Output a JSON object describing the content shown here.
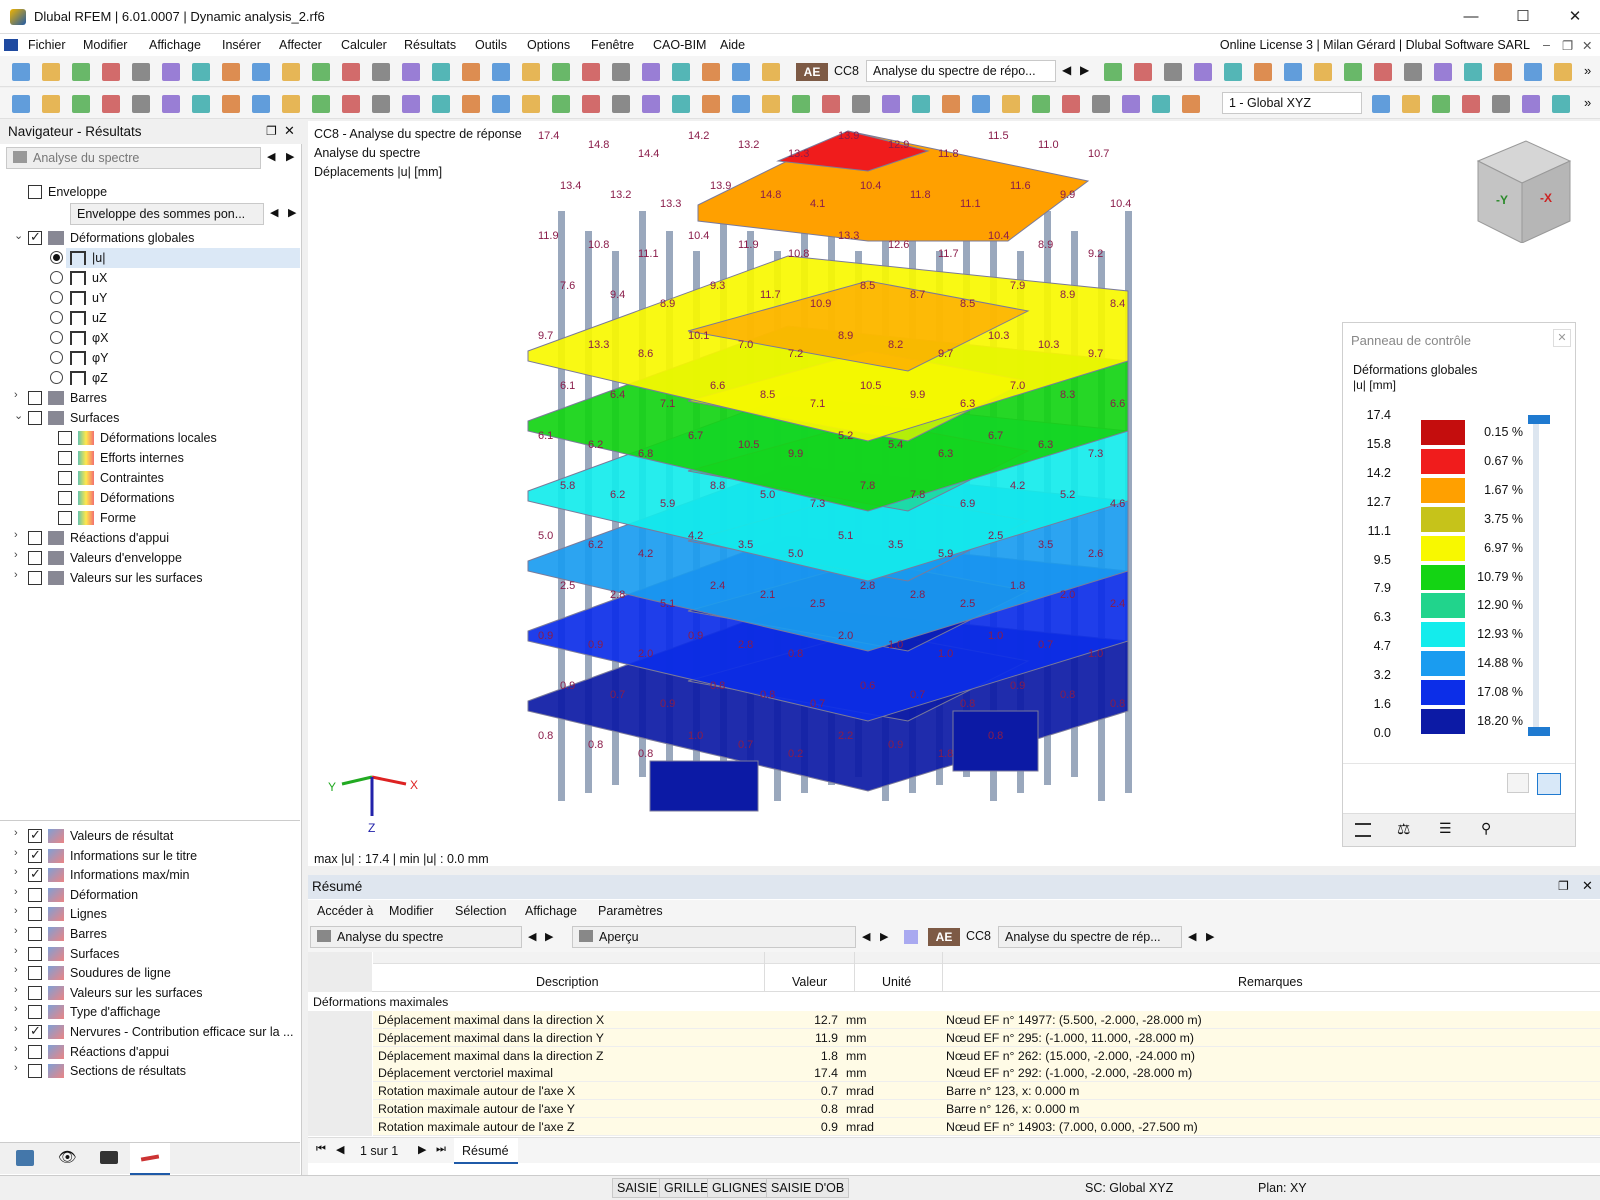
{
  "window": {
    "title": "Dlubal RFEM | 6.01.0007 | Dynamic analysis_2.rf6",
    "minimize": "—",
    "maximize": "☐",
    "close": "✕"
  },
  "menu": {
    "items": [
      "Fichier",
      "Modifier",
      "Affichage",
      "Insérer",
      "Affecter",
      "Calculer",
      "Résultats",
      "Outils",
      "Options",
      "Fenêtre",
      "CAO-BIM",
      "Aide"
    ],
    "license": "Online License 3 | Milan Gérard | Dlubal Software SARL"
  },
  "toolbar": {
    "ae_badge": "AE",
    "loadcase": "CC8",
    "loadcase_name": "Analyse du spectre de répo...",
    "view_combo": "1 - Global XYZ",
    "more": "»"
  },
  "navigator": {
    "title": "Navigateur - Résultats",
    "analysis_combo": "Analyse du spectre",
    "enveloppe_label": "Enveloppe",
    "enveloppe_combo": "Enveloppe des sommes pon...",
    "tree": [
      {
        "label": "Déformations globales",
        "checked": true,
        "expanded": true
      },
      {
        "label": "|u|",
        "radio": true,
        "on": true
      },
      {
        "label": "uX",
        "radio": true
      },
      {
        "label": "uY",
        "radio": true
      },
      {
        "label": "uZ",
        "radio": true
      },
      {
        "label": "φX",
        "radio": true
      },
      {
        "label": "φY",
        "radio": true
      },
      {
        "label": "φZ",
        "radio": true
      },
      {
        "label": "Barres"
      },
      {
        "label": "Surfaces",
        "expanded": true
      },
      {
        "label": "Déformations locales"
      },
      {
        "label": "Efforts internes"
      },
      {
        "label": "Contraintes"
      },
      {
        "label": "Déformations"
      },
      {
        "label": "Forme"
      },
      {
        "label": "Réactions d'appui"
      },
      {
        "label": "Valeurs d'enveloppe"
      },
      {
        "label": "Valeurs sur les surfaces"
      }
    ],
    "bottom_tree": [
      {
        "label": "Valeurs de résultat",
        "checked": true
      },
      {
        "label": "Informations sur le titre",
        "checked": true
      },
      {
        "label": "Informations max/min",
        "checked": true
      },
      {
        "label": "Déformation"
      },
      {
        "label": "Lignes"
      },
      {
        "label": "Barres"
      },
      {
        "label": "Surfaces"
      },
      {
        "label": "Soudures de ligne"
      },
      {
        "label": "Valeurs sur les surfaces"
      },
      {
        "label": "Type d'affichage"
      },
      {
        "label": "Nervures - Contribution efficace sur la ...",
        "checked": true
      },
      {
        "label": "Réactions d'appui"
      },
      {
        "label": "Sections de résultats"
      }
    ]
  },
  "view": {
    "info_line1": "CC8 - Analyse du spectre de réponse",
    "info_line2": "Analyse du spectre",
    "info_line3": "Déplacements |u| [mm]",
    "maxmin": "max |u| : 17.4 | min |u| : 0.0 mm",
    "axis_x": "X",
    "axis_y": "Y",
    "axis_z": "Z",
    "cube_y": "-Y",
    "cube_x": "-X",
    "labels": [
      "17.4",
      "14.8",
      "14.4",
      "14.2",
      "13.2",
      "13.3",
      "13.9",
      "12.9",
      "11.8",
      "11.5",
      "11.0",
      "10.7",
      "13.4",
      "13.2",
      "13.3",
      "13.9",
      "14.8",
      "4.1",
      "10.4",
      "11.8",
      "11.1",
      "11.6",
      "9.9",
      "10.4",
      "11.9",
      "10.8",
      "11.1",
      "10.4",
      "11.9",
      "10.8",
      "13.3",
      "12.6",
      "11.7",
      "10.4",
      "8.9",
      "9.2",
      "7.6",
      "9.4",
      "8.9",
      "9.3",
      "11.7",
      "10.9",
      "8.5",
      "8.7",
      "8.5",
      "7.9",
      "8.9",
      "8.4",
      "9.7",
      "13.3",
      "8.6",
      "10.1",
      "7.0",
      "7.2",
      "8.9",
      "8.2",
      "9.7",
      "10.3",
      "10.3",
      "9.7",
      "6.1",
      "6.4",
      "7.1",
      "6.6",
      "8.5",
      "7.1",
      "10.5",
      "9.9",
      "6.3",
      "7.0",
      "8.3",
      "6.6",
      "6.1",
      "6.2",
      "6.8",
      "6.7",
      "10.5",
      "9.9",
      "5.2",
      "5.4",
      "6.3",
      "6.7",
      "6.3",
      "7.3",
      "5.8",
      "6.2",
      "5.9",
      "8.8",
      "5.0",
      "7.3",
      "7.8",
      "7.8",
      "6.9",
      "4.2",
      "5.2",
      "4.6",
      "5.0",
      "6.2",
      "4.2",
      "4.2",
      "3.5",
      "5.0",
      "5.1",
      "3.5",
      "5.9",
      "2.5",
      "3.5",
      "2.6",
      "2.5",
      "2.8",
      "5.1",
      "2.4",
      "2.1",
      "2.5",
      "2.8",
      "2.8",
      "2.5",
      "1.8",
      "2.0",
      "2.4",
      "0.9",
      "0.9",
      "2.0",
      "0.9",
      "2.8",
      "0.8",
      "2.0",
      "1.0",
      "1.0",
      "1.0",
      "0.7",
      "1.0",
      "0.9",
      "0.7",
      "0.9",
      "0.8",
      "0.8",
      "0.7",
      "0.6",
      "0.7",
      "0.8",
      "0.9",
      "0.8",
      "0.8",
      "0.8",
      "0.8",
      "0.8",
      "1.0",
      "0.7",
      "0.2",
      "2.2",
      "0.9",
      "1.8",
      "0.8"
    ]
  },
  "control_panel": {
    "title": "Panneau de contrôle",
    "close": "✕",
    "heading": "Déformations globales",
    "unit": "|u| [mm]",
    "legend_values": [
      "17.4",
      "15.8",
      "14.2",
      "12.7",
      "11.1",
      "9.5",
      "7.9",
      "6.3",
      "4.7",
      "3.2",
      "1.6",
      "0.0"
    ],
    "legend_colors": [
      "#c40d0d",
      "#f01c1c",
      "#ffa000",
      "#c6c31a",
      "#f8f800",
      "#14d414",
      "#21d48c",
      "#14ecec",
      "#1a9cf0",
      "#0c2ee8",
      "#0c1aa5"
    ],
    "legend_percents": [
      "0.15 %",
      "0.67 %",
      "1.67 %",
      "3.75 %",
      "6.97 %",
      "10.79 %",
      "12.90 %",
      "12.93 %",
      "14.88 %",
      "17.08 %",
      "18.20 %"
    ]
  },
  "summary": {
    "title": "Résumé",
    "menu": [
      "Accéder à",
      "Modifier",
      "Sélection",
      "Affichage",
      "Paramètres"
    ],
    "analysis_combo": "Analyse du spectre",
    "view_combo": "Aperçu",
    "ae_badge": "AE",
    "loadcase": "CC8",
    "loadcase_name": "Analyse du spectre de rép...",
    "columns": [
      "Description",
      "Valeur",
      "Unité",
      "Remarques"
    ],
    "group": "Déformations maximales",
    "rows": [
      {
        "desc": "Déplacement maximal dans la direction X",
        "value": "12.7",
        "unit": "mm",
        "remark": "Nœud EF n° 14977: (5.500, -2.000, -28.000 m)"
      },
      {
        "desc": "Déplacement maximal dans la direction Y",
        "value": "11.9",
        "unit": "mm",
        "remark": "Nœud EF n° 295: (-1.000, 11.000, -28.000 m)"
      },
      {
        "desc": "Déplacement maximal dans la direction Z",
        "value": "1.8",
        "unit": "mm",
        "remark": "Nœud EF n° 262: (15.000, -2.000, -24.000 m)"
      },
      {
        "desc": "Déplacement verctoriel maximal",
        "value": "17.4",
        "unit": "mm",
        "remark": "Nœud EF n° 292: (-1.000, -2.000, -28.000 m)"
      },
      {
        "desc": "Rotation maximale autour de l'axe X",
        "value": "0.7",
        "unit": "mrad",
        "remark": "Barre n° 123, x: 0.000 m"
      },
      {
        "desc": "Rotation maximale autour de l'axe Y",
        "value": "0.8",
        "unit": "mrad",
        "remark": "Barre n° 126, x: 0.000 m"
      },
      {
        "desc": "Rotation maximale autour de l'axe Z",
        "value": "0.9",
        "unit": "mrad",
        "remark": "Nœud EF n° 14903: (7.000, 0.000, -27.500 m)"
      }
    ],
    "pager": "1 sur 1",
    "tab": "Résumé"
  },
  "status": {
    "buttons": [
      "SAISIE",
      "GRILLE",
      "GLIGNES",
      "SAISIE D'OB"
    ],
    "sc": "SC: Global XYZ",
    "plan": "Plan: XY"
  }
}
